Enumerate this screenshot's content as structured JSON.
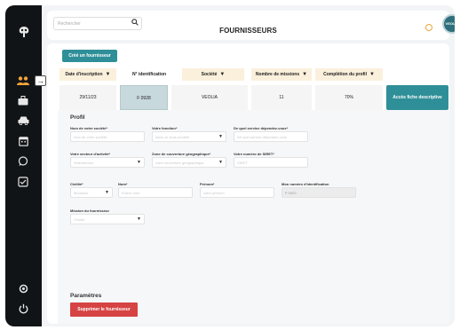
{
  "sidebar": {
    "icons": [
      {
        "name": "tree-logo-icon"
      },
      {
        "name": "users-icon"
      },
      {
        "name": "briefcase-icon"
      },
      {
        "name": "car-icon"
      },
      {
        "name": "calendar-icon"
      },
      {
        "name": "chat-icon"
      },
      {
        "name": "checklist-icon"
      },
      {
        "name": "settings-icon"
      },
      {
        "name": "power-icon"
      }
    ],
    "accent": "#f2a33a"
  },
  "topbar": {
    "search_placeholder": "Rechercher",
    "title": "FOURNISSEURS",
    "avatar_text": "VEOLIA"
  },
  "toolbar": {
    "create_label": "Créé un fournisseur"
  },
  "table": {
    "headers": [
      "Date d'inscription",
      "N° identification",
      "Société",
      "Nombre de missions",
      "Complétion du profil"
    ],
    "row": {
      "date": "29/11/23",
      "id": "F 0928",
      "company": "VEOLIA",
      "missions": "11",
      "completion": "70%"
    },
    "action_label": "Accès fiche descriptive"
  },
  "profile": {
    "title": "Profil",
    "fields": {
      "company_name": {
        "label": "Nom de votre société*",
        "placeholder": "nom de votre société"
      },
      "role": {
        "label": "Votre fonction*",
        "placeholder": "dans un sous-modèle"
      },
      "department": {
        "label": "De quel service dépendez-vous*",
        "placeholder": "De quel service dépendez-vous"
      },
      "sector": {
        "label": "Votre secteur d'activité*",
        "placeholder": "Sélectionner"
      },
      "zone": {
        "label": "Zone de couverture géographique*",
        "placeholder": "votre couverture géographique"
      },
      "siret": {
        "label": "Votre numéro de SIRET*",
        "placeholder": "SIRET"
      },
      "civility": {
        "label": "Civilité*",
        "placeholder": "Monsieur"
      },
      "last_name": {
        "label": "Nom*",
        "placeholder": "Entrez nom"
      },
      "first_name": {
        "label": "Prénom*",
        "placeholder": "votre prénom"
      },
      "ident_number": {
        "label": "Mon numéro d'identification",
        "value": "F 0920"
      },
      "mission": {
        "label": "Mission du fournisseur",
        "placeholder": "Choisir"
      }
    }
  },
  "params": {
    "title": "Paramètres",
    "delete_label": "Supprimer le fournisseur"
  },
  "colors": {
    "primary": "#2f8f98",
    "danger": "#d64343",
    "header_bg": "#fbf0dc"
  }
}
